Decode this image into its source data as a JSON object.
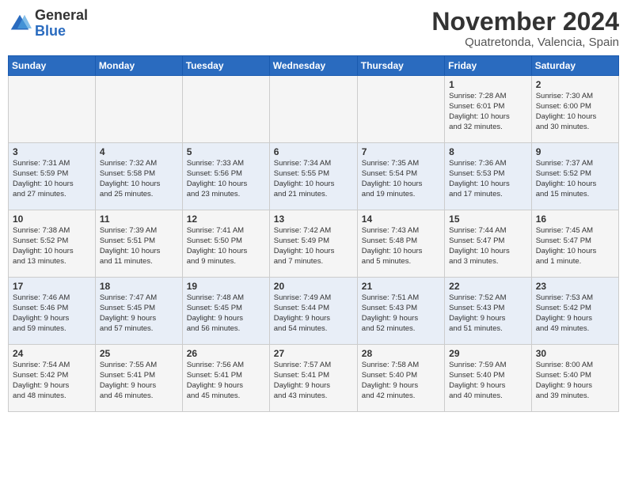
{
  "header": {
    "logo_line1": "General",
    "logo_line2": "Blue",
    "month_title": "November 2024",
    "location": "Quatretonda, Valencia, Spain"
  },
  "days_of_week": [
    "Sunday",
    "Monday",
    "Tuesday",
    "Wednesday",
    "Thursday",
    "Friday",
    "Saturday"
  ],
  "weeks": [
    [
      {
        "day": "",
        "info": ""
      },
      {
        "day": "",
        "info": ""
      },
      {
        "day": "",
        "info": ""
      },
      {
        "day": "",
        "info": ""
      },
      {
        "day": "",
        "info": ""
      },
      {
        "day": "1",
        "info": "Sunrise: 7:28 AM\nSunset: 6:01 PM\nDaylight: 10 hours\nand 32 minutes."
      },
      {
        "day": "2",
        "info": "Sunrise: 7:30 AM\nSunset: 6:00 PM\nDaylight: 10 hours\nand 30 minutes."
      }
    ],
    [
      {
        "day": "3",
        "info": "Sunrise: 7:31 AM\nSunset: 5:59 PM\nDaylight: 10 hours\nand 27 minutes."
      },
      {
        "day": "4",
        "info": "Sunrise: 7:32 AM\nSunset: 5:58 PM\nDaylight: 10 hours\nand 25 minutes."
      },
      {
        "day": "5",
        "info": "Sunrise: 7:33 AM\nSunset: 5:56 PM\nDaylight: 10 hours\nand 23 minutes."
      },
      {
        "day": "6",
        "info": "Sunrise: 7:34 AM\nSunset: 5:55 PM\nDaylight: 10 hours\nand 21 minutes."
      },
      {
        "day": "7",
        "info": "Sunrise: 7:35 AM\nSunset: 5:54 PM\nDaylight: 10 hours\nand 19 minutes."
      },
      {
        "day": "8",
        "info": "Sunrise: 7:36 AM\nSunset: 5:53 PM\nDaylight: 10 hours\nand 17 minutes."
      },
      {
        "day": "9",
        "info": "Sunrise: 7:37 AM\nSunset: 5:52 PM\nDaylight: 10 hours\nand 15 minutes."
      }
    ],
    [
      {
        "day": "10",
        "info": "Sunrise: 7:38 AM\nSunset: 5:52 PM\nDaylight: 10 hours\nand 13 minutes."
      },
      {
        "day": "11",
        "info": "Sunrise: 7:39 AM\nSunset: 5:51 PM\nDaylight: 10 hours\nand 11 minutes."
      },
      {
        "day": "12",
        "info": "Sunrise: 7:41 AM\nSunset: 5:50 PM\nDaylight: 10 hours\nand 9 minutes."
      },
      {
        "day": "13",
        "info": "Sunrise: 7:42 AM\nSunset: 5:49 PM\nDaylight: 10 hours\nand 7 minutes."
      },
      {
        "day": "14",
        "info": "Sunrise: 7:43 AM\nSunset: 5:48 PM\nDaylight: 10 hours\nand 5 minutes."
      },
      {
        "day": "15",
        "info": "Sunrise: 7:44 AM\nSunset: 5:47 PM\nDaylight: 10 hours\nand 3 minutes."
      },
      {
        "day": "16",
        "info": "Sunrise: 7:45 AM\nSunset: 5:47 PM\nDaylight: 10 hours\nand 1 minute."
      }
    ],
    [
      {
        "day": "17",
        "info": "Sunrise: 7:46 AM\nSunset: 5:46 PM\nDaylight: 9 hours\nand 59 minutes."
      },
      {
        "day": "18",
        "info": "Sunrise: 7:47 AM\nSunset: 5:45 PM\nDaylight: 9 hours\nand 57 minutes."
      },
      {
        "day": "19",
        "info": "Sunrise: 7:48 AM\nSunset: 5:45 PM\nDaylight: 9 hours\nand 56 minutes."
      },
      {
        "day": "20",
        "info": "Sunrise: 7:49 AM\nSunset: 5:44 PM\nDaylight: 9 hours\nand 54 minutes."
      },
      {
        "day": "21",
        "info": "Sunrise: 7:51 AM\nSunset: 5:43 PM\nDaylight: 9 hours\nand 52 minutes."
      },
      {
        "day": "22",
        "info": "Sunrise: 7:52 AM\nSunset: 5:43 PM\nDaylight: 9 hours\nand 51 minutes."
      },
      {
        "day": "23",
        "info": "Sunrise: 7:53 AM\nSunset: 5:42 PM\nDaylight: 9 hours\nand 49 minutes."
      }
    ],
    [
      {
        "day": "24",
        "info": "Sunrise: 7:54 AM\nSunset: 5:42 PM\nDaylight: 9 hours\nand 48 minutes."
      },
      {
        "day": "25",
        "info": "Sunrise: 7:55 AM\nSunset: 5:41 PM\nDaylight: 9 hours\nand 46 minutes."
      },
      {
        "day": "26",
        "info": "Sunrise: 7:56 AM\nSunset: 5:41 PM\nDaylight: 9 hours\nand 45 minutes."
      },
      {
        "day": "27",
        "info": "Sunrise: 7:57 AM\nSunset: 5:41 PM\nDaylight: 9 hours\nand 43 minutes."
      },
      {
        "day": "28",
        "info": "Sunrise: 7:58 AM\nSunset: 5:40 PM\nDaylight: 9 hours\nand 42 minutes."
      },
      {
        "day": "29",
        "info": "Sunrise: 7:59 AM\nSunset: 5:40 PM\nDaylight: 9 hours\nand 40 minutes."
      },
      {
        "day": "30",
        "info": "Sunrise: 8:00 AM\nSunset: 5:40 PM\nDaylight: 9 hours\nand 39 minutes."
      }
    ]
  ]
}
